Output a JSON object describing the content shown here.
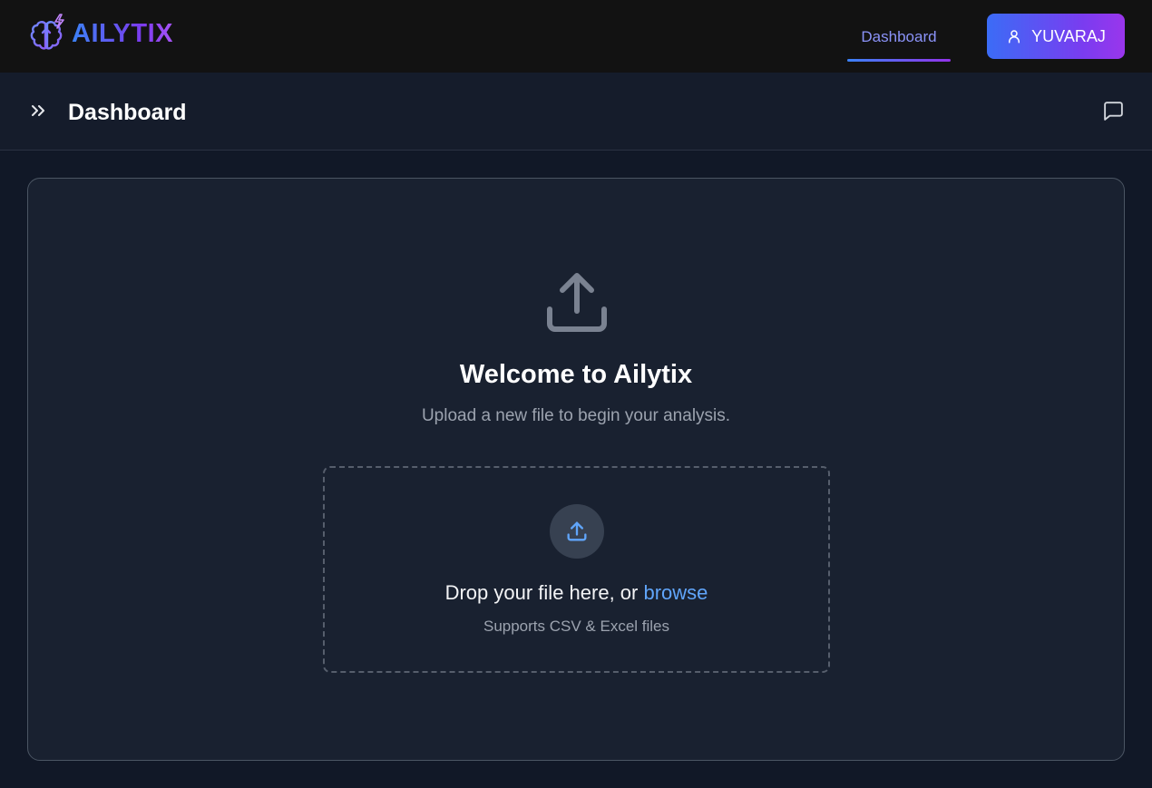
{
  "brand": {
    "name": "AILYTIX",
    "logo_icon": "brain-lightning-icon"
  },
  "nav": {
    "tabs": [
      {
        "label": "Dashboard",
        "active": true
      }
    ]
  },
  "user": {
    "name": "YUVARAJ",
    "icon": "user-icon"
  },
  "page_header": {
    "title": "Dashboard",
    "expand_icon": "chevrons-right-icon",
    "chat_icon": "message-square-icon"
  },
  "main": {
    "hero_icon": "upload-icon",
    "welcome_title": "Welcome to Ailytix",
    "welcome_subtitle": "Upload a new file to begin your analysis.",
    "dropzone": {
      "icon": "upload-icon",
      "text_prefix": "Drop your file here, or ",
      "browse_label": "browse",
      "hint": "Supports CSV & Excel files"
    }
  },
  "colors": {
    "topbar_bg": "#121212",
    "page_bg": "#111827",
    "card_bg": "#192130",
    "accent_blue": "#3b82f6",
    "accent_purple": "#9333ea",
    "link": "#60a5fa"
  }
}
